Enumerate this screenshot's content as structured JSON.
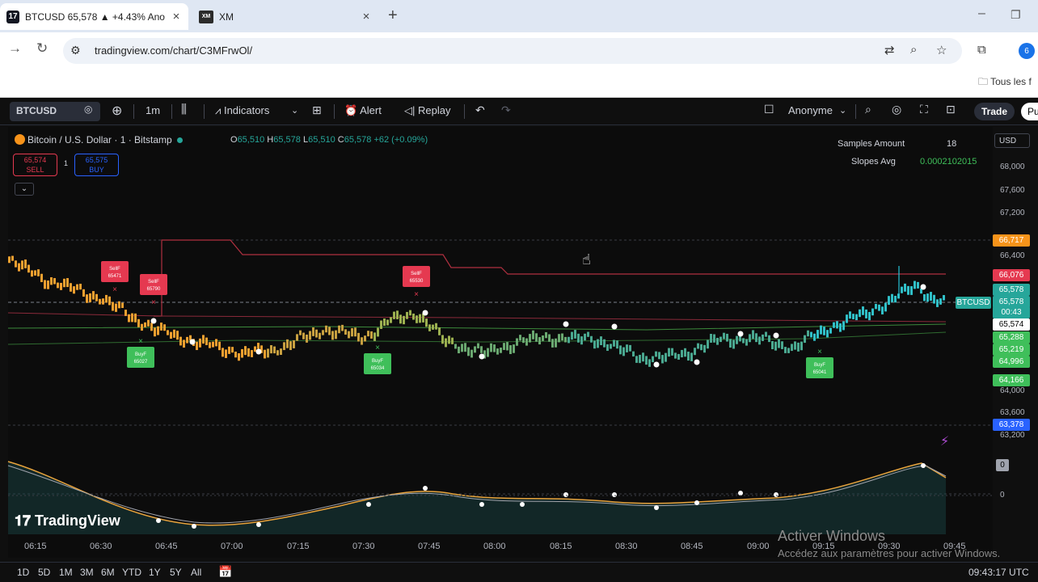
{
  "browser": {
    "tabs": [
      {
        "title": "BTCUSD 65,578 ▲ +4.43% Ano",
        "favicon": "tradingview-icon",
        "active": true
      },
      {
        "title": "XM",
        "favicon": "xm-icon",
        "active": false
      }
    ],
    "url": "tradingview.com/chart/C3MFrwOl/",
    "bookmark": "Tous les f"
  },
  "toolbar": {
    "symbol": "BTCUSD",
    "interval": "1m",
    "indicators": "Indicators",
    "alert": "Alert",
    "replay": "Replay",
    "layout_name": "Anonyme",
    "trade": "Trade",
    "publish": "Pu"
  },
  "legend": {
    "title": "Bitcoin / U.S. Dollar · 1 · Bitstamp",
    "o_label": "O",
    "o": "65,510",
    "h_label": "H",
    "h": "65,578",
    "l_label": "L",
    "l": "65,510",
    "c_label": "C",
    "c": "65,578",
    "change": "+62 (+0.09%)",
    "sell_price": "65,574",
    "sell_label": "SELL",
    "buy_price": "65,575",
    "buy_label": "BUY",
    "spread": "1"
  },
  "stats": {
    "samples_label": "Samples Amount",
    "samples_value": "18",
    "slopes_label": "Slopes Avg",
    "slopes_value": "0.0002102015"
  },
  "price_scale": {
    "currency": "USD",
    "labels": [
      "68,000",
      "67,600",
      "67,200",
      "66,400",
      "64,000",
      "63,600",
      "63,200"
    ],
    "badges": [
      {
        "text": "66,717",
        "color": "#f7931a"
      },
      {
        "text": "66,076",
        "color": "#e53950"
      },
      {
        "text": "65,578",
        "color": "#26a69a"
      },
      {
        "text": "65,578",
        "color": "#26a69a"
      },
      {
        "text": "00:43",
        "color": "#26a69a"
      },
      {
        "text": "65,574",
        "color": "#ffffff"
      },
      {
        "text": "65,288",
        "color": "#3fbf5a"
      },
      {
        "text": "65,219",
        "color": "#3fbf5a"
      },
      {
        "text": "64,996",
        "color": "#3fbf5a"
      },
      {
        "text": "64,166",
        "color": "#3fbf5a"
      },
      {
        "text": "63,378",
        "color": "#2962ff"
      }
    ],
    "symbol_tag": "BTCUSD",
    "osc_badge": "0",
    "osc_zero": "0"
  },
  "signals": [
    {
      "type": "SellBuy",
      "label": "SellF",
      "price": "65471"
    },
    {
      "type": "SellBuy",
      "label": "SellF",
      "price": "65790"
    },
    {
      "type": "SellBuy",
      "label": "SellF",
      "price": "65530"
    },
    {
      "type": "BuyBuy",
      "label": "BuyF",
      "price": "65027"
    },
    {
      "type": "BuyBuy",
      "label": "BuyF",
      "price": "65034"
    },
    {
      "type": "BuyBuy",
      "label": "BuyF",
      "price": "65041"
    }
  ],
  "time_axis": [
    "06:15",
    "06:30",
    "06:45",
    "07:00",
    "07:15",
    "07:30",
    "07:45",
    "08:00",
    "08:15",
    "08:30",
    "08:45",
    "09:00",
    "09:15",
    "09:30",
    "09:45"
  ],
  "branding": "TradingView",
  "bottom": {
    "ranges": [
      "1D",
      "5D",
      "1M",
      "3M",
      "6M",
      "YTD",
      "1Y",
      "5Y",
      "All"
    ],
    "clock": "09:43:17 UTC"
  },
  "watermark": {
    "line1": "Activer Windows",
    "line2": "Accédez aux paramètres pour activer Windows."
  }
}
